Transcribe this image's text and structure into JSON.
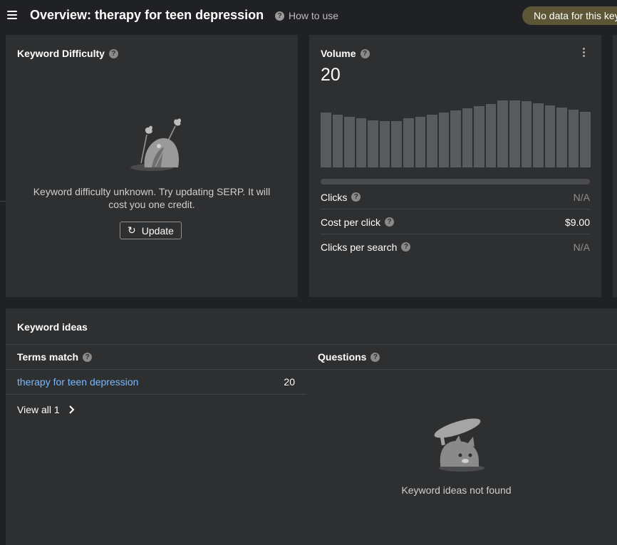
{
  "header": {
    "title": "Overview: therapy for teen depression",
    "how_to_use": "How to use",
    "badge": "No data for this key"
  },
  "keyword_difficulty": {
    "title": "Keyword Difficulty",
    "message": "Keyword difficulty unknown. Try updating SERP. It will cost you one credit.",
    "update_label": "Update"
  },
  "volume": {
    "title": "Volume",
    "value": "20",
    "trend": [
      0.82,
      0.79,
      0.76,
      0.73,
      0.7,
      0.69,
      0.69,
      0.73,
      0.76,
      0.79,
      0.82,
      0.85,
      0.88,
      0.92,
      0.95,
      1.0,
      1.0,
      0.99,
      0.96,
      0.93,
      0.89,
      0.86,
      0.83
    ],
    "metrics": [
      {
        "label": "Clicks",
        "value": "N/A"
      },
      {
        "label": "Cost per click",
        "value": "$9.00"
      },
      {
        "label": "Clicks per search",
        "value": "N/A"
      }
    ]
  },
  "keyword_ideas": {
    "title": "Keyword ideas",
    "terms_match": {
      "heading": "Terms match",
      "rows": [
        {
          "term": "therapy for teen depression",
          "volume": "20"
        }
      ],
      "view_all": "View all 1"
    },
    "questions": {
      "heading": "Questions",
      "empty_message": "Keyword ideas not found"
    }
  },
  "icons": {
    "menu": "hamburger-icon",
    "help": "question-circle-icon",
    "refresh": "refresh-icon",
    "more": "kebab-icon",
    "chevron": "chevron-right-icon"
  },
  "colors": {
    "background": "#202124",
    "card": "#2e2f31",
    "link": "#79b8ff",
    "badge": "#5c5636",
    "bar": "#5a5b5d"
  }
}
